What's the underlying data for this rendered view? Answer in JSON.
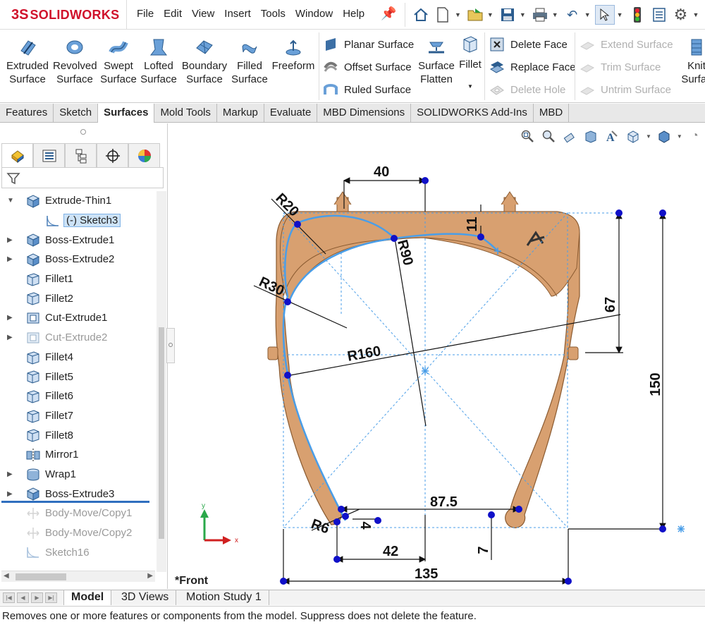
{
  "app": {
    "logo_prefix": "3S",
    "logo_text": "SOLIDWORKS"
  },
  "menu": [
    "File",
    "Edit",
    "View",
    "Insert",
    "Tools",
    "Window",
    "Help"
  ],
  "ribbon": {
    "big_buttons": [
      {
        "l1": "Extruded",
        "l2": "Surface"
      },
      {
        "l1": "Revolved",
        "l2": "Surface"
      },
      {
        "l1": "Swept",
        "l2": "Surface"
      },
      {
        "l1": "Lofted",
        "l2": "Surface"
      },
      {
        "l1": "Boundary",
        "l2": "Surface"
      },
      {
        "l1": "Filled",
        "l2": "Surface"
      },
      {
        "l1": "Freeform",
        "l2": ""
      }
    ],
    "planar_surface": "Planar Surface",
    "offset_surface": "Offset Surface",
    "ruled_surface": "Ruled Surface",
    "surface_flatten_l1": "Surface",
    "surface_flatten_l2": "Flatten",
    "fillet": "Fillet",
    "delete_face": "Delete Face",
    "replace_face": "Replace Face",
    "delete_hole": "Delete Hole",
    "extend_surface": "Extend Surface",
    "trim_surface": "Trim Surface",
    "untrim_surface": "Untrim Surface",
    "knit_l1": "Knit",
    "knit_l2": "Surfac"
  },
  "command_tabs": [
    "Features",
    "Sketch",
    "Surfaces",
    "Mold Tools",
    "Markup",
    "Evaluate",
    "MBD Dimensions",
    "SOLIDWORKS Add-Ins",
    "MBD"
  ],
  "active_command_tab": "Surfaces",
  "tree": [
    {
      "label": "Extrude-Thin1",
      "expand": true,
      "state": "normal"
    },
    {
      "label": "(-) Sketch3",
      "expand": false,
      "state": "selected"
    },
    {
      "label": "Boss-Extrude1",
      "expand": true,
      "state": "normal"
    },
    {
      "label": "Boss-Extrude2",
      "expand": true,
      "state": "normal"
    },
    {
      "label": "Fillet1",
      "expand": false,
      "state": "normal"
    },
    {
      "label": "Fillet2",
      "expand": false,
      "state": "normal"
    },
    {
      "label": "Cut-Extrude1",
      "expand": true,
      "state": "normal"
    },
    {
      "label": "Cut-Extrude2",
      "expand": true,
      "state": "dim"
    },
    {
      "label": "Fillet4",
      "expand": false,
      "state": "normal"
    },
    {
      "label": "Fillet5",
      "expand": false,
      "state": "normal"
    },
    {
      "label": "Fillet6",
      "expand": false,
      "state": "normal"
    },
    {
      "label": "Fillet7",
      "expand": false,
      "state": "normal"
    },
    {
      "label": "Fillet8",
      "expand": false,
      "state": "normal"
    },
    {
      "label": "Mirror1",
      "expand": false,
      "state": "normal"
    },
    {
      "label": "Wrap1",
      "expand": true,
      "state": "normal"
    },
    {
      "label": "Boss-Extrude3",
      "expand": true,
      "state": "normal"
    },
    {
      "label": "Body-Move/Copy1",
      "expand": false,
      "state": "dim"
    },
    {
      "label": "Body-Move/Copy2",
      "expand": false,
      "state": "dim"
    },
    {
      "label": "Sketch16",
      "expand": false,
      "state": "dim"
    }
  ],
  "dimensions": {
    "d40": "40",
    "d11": "11",
    "r20": "R20",
    "r90": "R90",
    "r30": "R30",
    "d67": "67",
    "r160": "R160",
    "d150": "150",
    "d87_5": "87.5",
    "r6": "R6",
    "d4": "4",
    "d42": "42",
    "d7": "7",
    "d135": "135"
  },
  "axis": {
    "x": "x",
    "y": "y"
  },
  "view_label": "*Front",
  "bottom_tabs": [
    "Model",
    "3D Views",
    "Motion Study 1"
  ],
  "active_bottom_tab": "Model",
  "status_text": "Removes one or more features or components from the model. Suppress does not delete the feature.",
  "colors": {
    "part": "#d8a070",
    "part_edge": "#8a5a30",
    "sketch": "#4a9ee8",
    "point": "#1010c8",
    "accent": "#d0112b"
  }
}
